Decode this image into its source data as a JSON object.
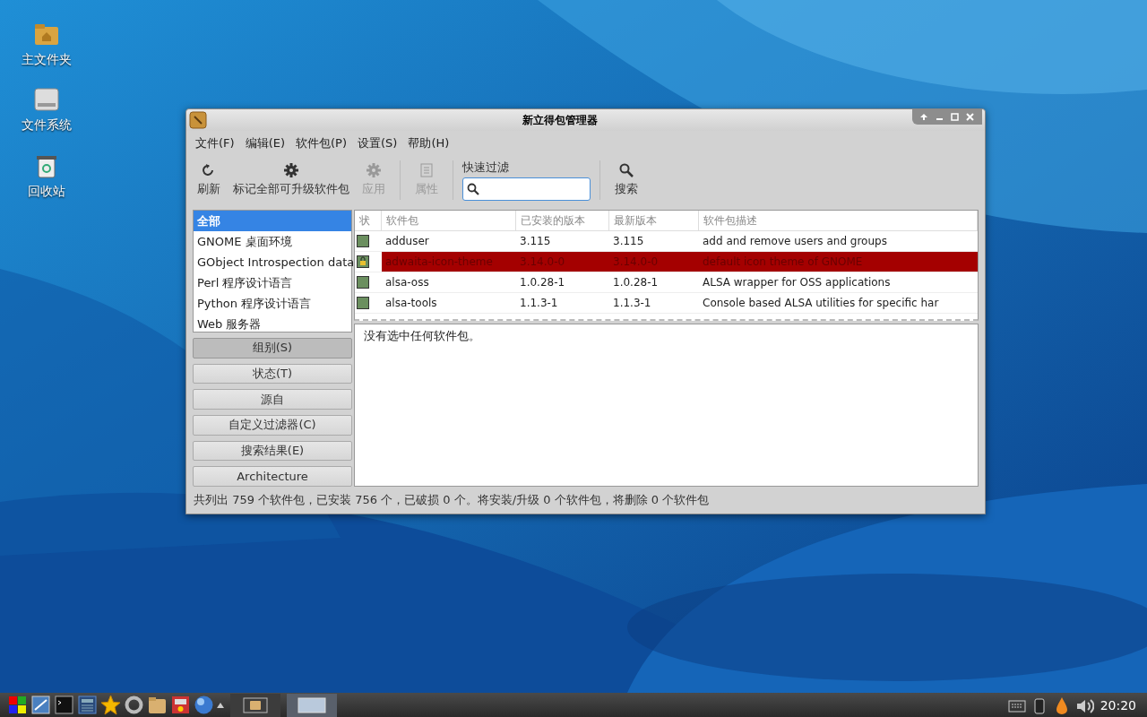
{
  "desktop_icons": [
    {
      "label": "主文件夹",
      "kind": "home"
    },
    {
      "label": "文件系统",
      "kind": "drive"
    },
    {
      "label": "回收站",
      "kind": "trash"
    }
  ],
  "window": {
    "title": "新立得包管理器",
    "menu": [
      "文件(F)",
      "编辑(E)",
      "软件包(P)",
      "设置(S)",
      "帮助(H)"
    ],
    "toolbar": [
      {
        "label": "刷新",
        "kind": "reload",
        "disabled": false
      },
      {
        "label": "标记全部可升级软件包",
        "kind": "gear",
        "disabled": false
      },
      {
        "label": "应用",
        "kind": "gear",
        "disabled": true
      },
      {
        "label": "属性",
        "kind": "list",
        "disabled": true
      }
    ],
    "quick_filter": {
      "label": "快速过滤"
    },
    "search_button": {
      "label": "搜索"
    },
    "sidebar": {
      "items": [
        {
          "label": "全部",
          "selected": true
        },
        {
          "label": "GNOME 桌面环境",
          "selected": false
        },
        {
          "label": "GObject Introspection data",
          "selected": false
        },
        {
          "label": "Perl 程序设计语言",
          "selected": false
        },
        {
          "label": "Python 程序设计语言",
          "selected": false
        },
        {
          "label": "Web 服务器",
          "selected": false
        }
      ]
    },
    "filter_buttons": [
      {
        "label": "组别(S)",
        "selected": true
      },
      {
        "label": "状态(T)",
        "selected": false
      },
      {
        "label": "源自",
        "selected": false
      },
      {
        "label": "自定义过滤器(C)",
        "selected": false
      },
      {
        "label": "搜索结果(E)",
        "selected": false
      },
      {
        "label": "Architecture",
        "selected": false
      }
    ],
    "table": {
      "columns": [
        "状",
        "软件包",
        "已安装的版本",
        "最新版本",
        "软件包描述"
      ],
      "rows": [
        {
          "name": "adduser",
          "installed": "3.115",
          "latest": "3.115",
          "description": "add and remove users and groups",
          "locked": false
        },
        {
          "name": "adwaita-icon-theme",
          "installed": "3.14.0-0",
          "latest": "3.14.0-0",
          "description": "default icon theme of GNOME",
          "locked": true
        },
        {
          "name": "alsa-oss",
          "installed": "1.0.28-1",
          "latest": "1.0.28-1",
          "description": "ALSA wrapper for OSS applications",
          "locked": false
        },
        {
          "name": "alsa-tools",
          "installed": "1.1.3-1",
          "latest": "1.1.3-1",
          "description": "Console based ALSA utilities for specific har",
          "locked": false
        }
      ]
    },
    "details": "没有选中任何软件包。",
    "status_bar": "共列出 759 个软件包，已安装 756 个，已破损 0 个。将安装/升级 0 个软件包，将删除 0 个软件包"
  },
  "taskbar": {
    "tasks": [
      {
        "kind": "folder",
        "selected": false
      },
      {
        "kind": "window",
        "selected": true
      }
    ],
    "clock": "20:20"
  }
}
